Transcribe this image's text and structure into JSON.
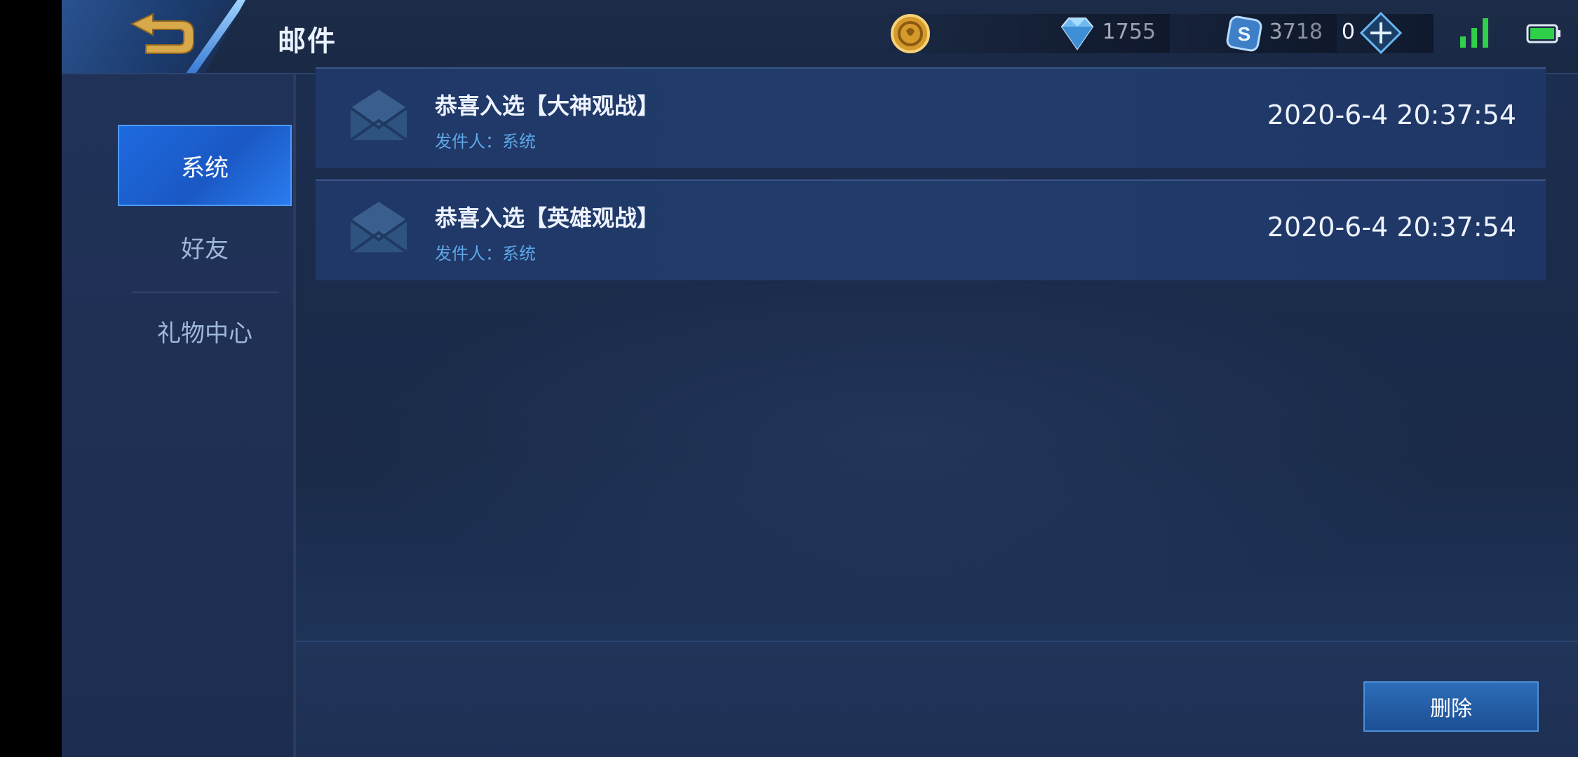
{
  "header": {
    "title": "邮件",
    "currencies": [
      {
        "name": "gold-coin",
        "value": "1755"
      },
      {
        "name": "diamond",
        "value": "3718"
      },
      {
        "name": "voucher",
        "value": "0"
      }
    ]
  },
  "sidebar": {
    "items": [
      {
        "label": "系统",
        "active": true
      },
      {
        "label": "好友",
        "active": false
      },
      {
        "label": "礼物中心",
        "active": false
      }
    ]
  },
  "mails": [
    {
      "title": "恭喜入选【大神观战】",
      "sender": "发件人：系统",
      "time": "2020-6-4 20:37:54"
    },
    {
      "title": "恭喜入选【英雄观战】",
      "sender": "发件人：系统",
      "time": "2020-6-4 20:37:54"
    }
  ],
  "actions": {
    "delete_label": "删除"
  },
  "colors": {
    "accent": "#1e6ae0",
    "sender": "#5fa6e6",
    "background": "#1b2b4b"
  }
}
